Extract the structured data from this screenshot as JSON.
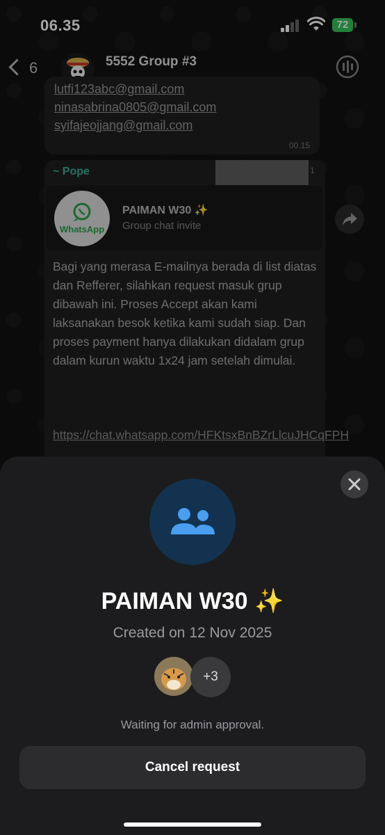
{
  "status_bar": {
    "time": "06.35",
    "battery": "72"
  },
  "header": {
    "back_count": "6",
    "group_name": "5552 Group #3",
    "group_subtitle": "~., ~., ~., ~., ~., ~., ~., ~., ~., ~., ~., ~., ~..."
  },
  "messages": {
    "emails": [
      "lutfi123abc@gmail.com",
      "ninasabrina0805@gmail.com",
      "syifajeojjang@gmail.com"
    ],
    "email_time": "00.15",
    "sender": "~ Pope",
    "time_fragment": "1",
    "invite": {
      "logo_text": "WhatsApp",
      "title": "PAIMAN W30 ✨",
      "subtitle": "Group chat invite"
    },
    "body": "Bagi yang merasa E-mailnya berada di list diatas dan Refferer, silahkan request masuk grup dibawah ini. Proses Accept akan kami laksanakan besok ketika kami sudah siap. Dan proses payment hanya dilakukan didalam grup dalam kurun waktu 1x24 jam setelah dimulai.",
    "link": "https://chat.whatsapp.com/HFKtsxBnBZrLlcuJHCqFPH"
  },
  "sheet": {
    "title": "PAIMAN W30 ✨",
    "created": "Created on 12 Nov 2025",
    "more_members": "+3",
    "status_text": "Waiting for admin approval.",
    "cancel_label": "Cancel request"
  },
  "colors": {
    "accent_green": "#3ab19a",
    "battery_green": "#34c759",
    "group_icon_blue": "#4a9ef0",
    "group_icon_bg": "#13324f"
  },
  "icons": [
    "back-chevron-icon",
    "group-avatar-icon",
    "voice-call-icon",
    "forward-icon",
    "close-icon",
    "group-people-icon",
    "signal-icon",
    "wifi-icon",
    "battery-icon"
  ]
}
